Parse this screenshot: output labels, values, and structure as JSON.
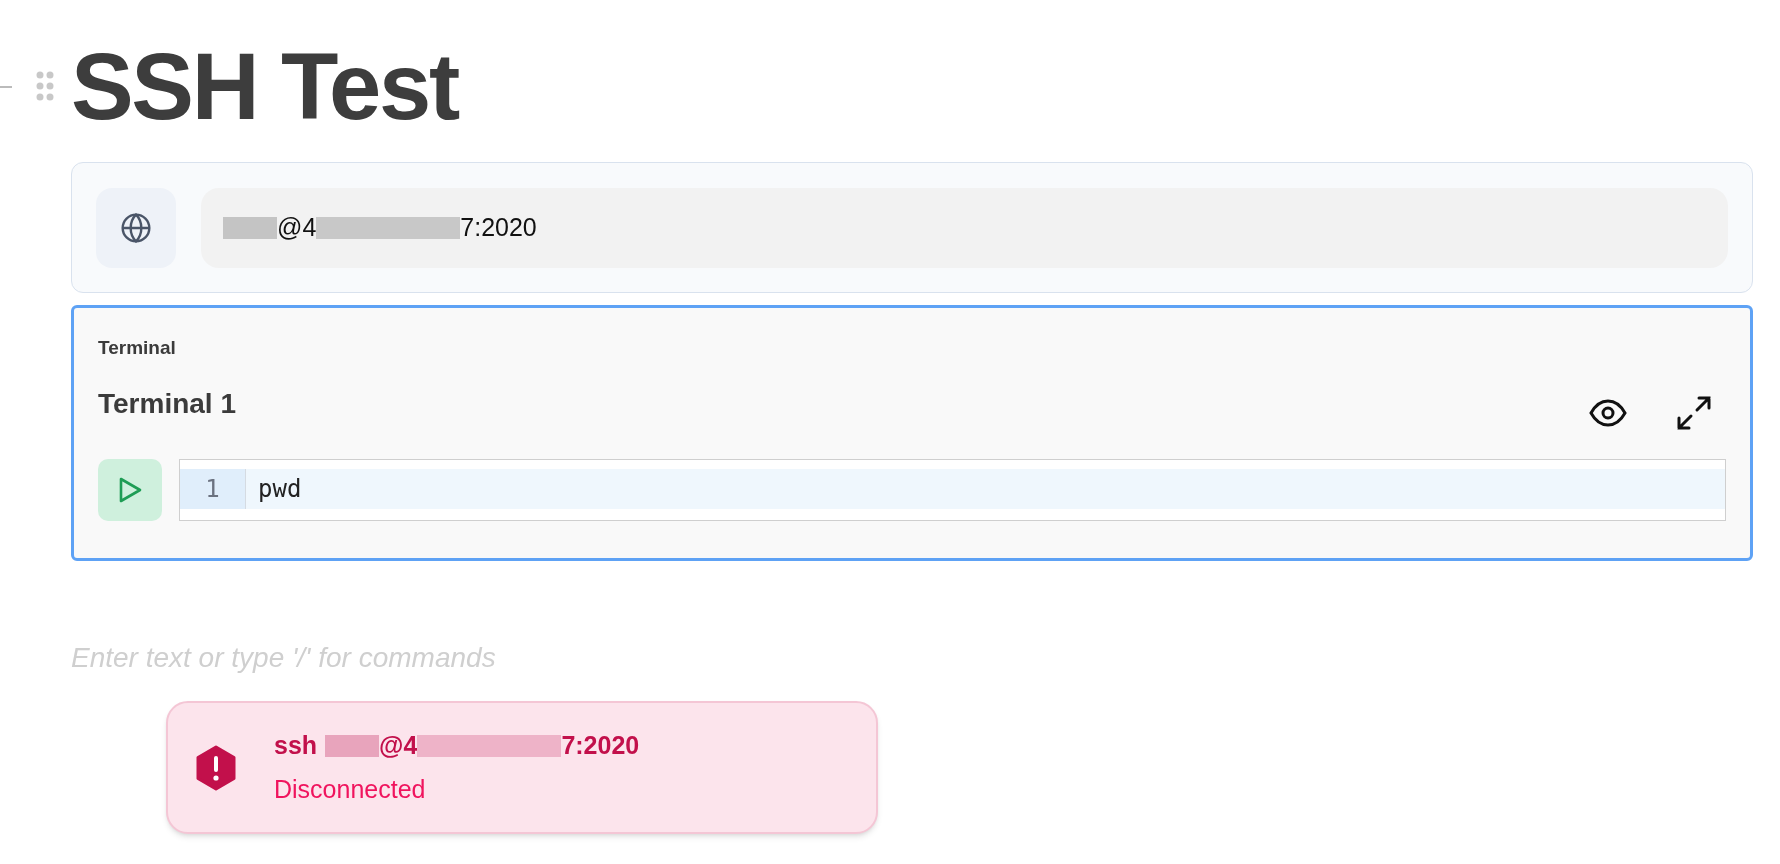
{
  "page": {
    "title": "SSH Test"
  },
  "connection": {
    "host_parts": [
      {
        "kind": "redacted_short"
      },
      {
        "kind": "text",
        "text": "@4"
      },
      {
        "kind": "redacted_long"
      },
      {
        "kind": "text",
        "text": "7:2020"
      }
    ]
  },
  "terminal_block": {
    "label": "Terminal",
    "name": "Terminal 1",
    "selected": true,
    "lines": [
      {
        "number": "1",
        "code": "pwd"
      }
    ]
  },
  "editor": {
    "placeholder": "Enter text or type '/' for commands"
  },
  "status_toast": {
    "prefix": "ssh",
    "host_parts": [
      {
        "kind": "redacted_short"
      },
      {
        "kind": "text",
        "text": "@4"
      },
      {
        "kind": "redacted_long"
      },
      {
        "kind": "text",
        "text": "7:2020"
      }
    ],
    "status": "Disconnected",
    "kind": "error"
  }
}
